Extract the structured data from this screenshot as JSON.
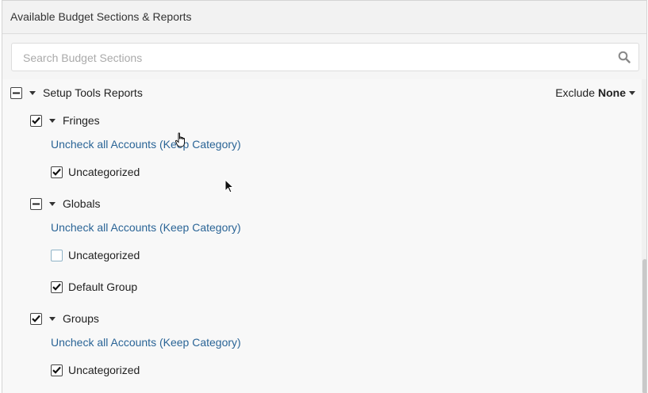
{
  "panel": {
    "title": "Available Budget Sections & Reports"
  },
  "search": {
    "placeholder": "Search Budget Sections",
    "value": "",
    "icon": "search-icon"
  },
  "exclude": {
    "label": "Exclude",
    "value": "None"
  },
  "tree": {
    "root": {
      "label": "Setup Tools Reports",
      "state": "partial"
    },
    "sections": [
      {
        "label": "Fringes",
        "state": "checked",
        "link": "Uncheck all Accounts (Keep Category)",
        "items": [
          {
            "label": "Uncategorized",
            "state": "checked"
          }
        ]
      },
      {
        "label": "Globals",
        "state": "partial",
        "link": "Uncheck all Accounts (Keep Category)",
        "items": [
          {
            "label": "Uncategorized",
            "state": "unchecked"
          },
          {
            "label": "Default Group",
            "state": "checked"
          }
        ]
      },
      {
        "label": "Groups",
        "state": "checked",
        "link": "Uncheck all Accounts (Keep Category)",
        "items": [
          {
            "label": "Uncategorized",
            "state": "checked"
          }
        ]
      }
    ]
  },
  "colors": {
    "link": "#2a6496",
    "panel_bg": "#f5f5f5",
    "tree_bg": "#f8f8f8"
  }
}
